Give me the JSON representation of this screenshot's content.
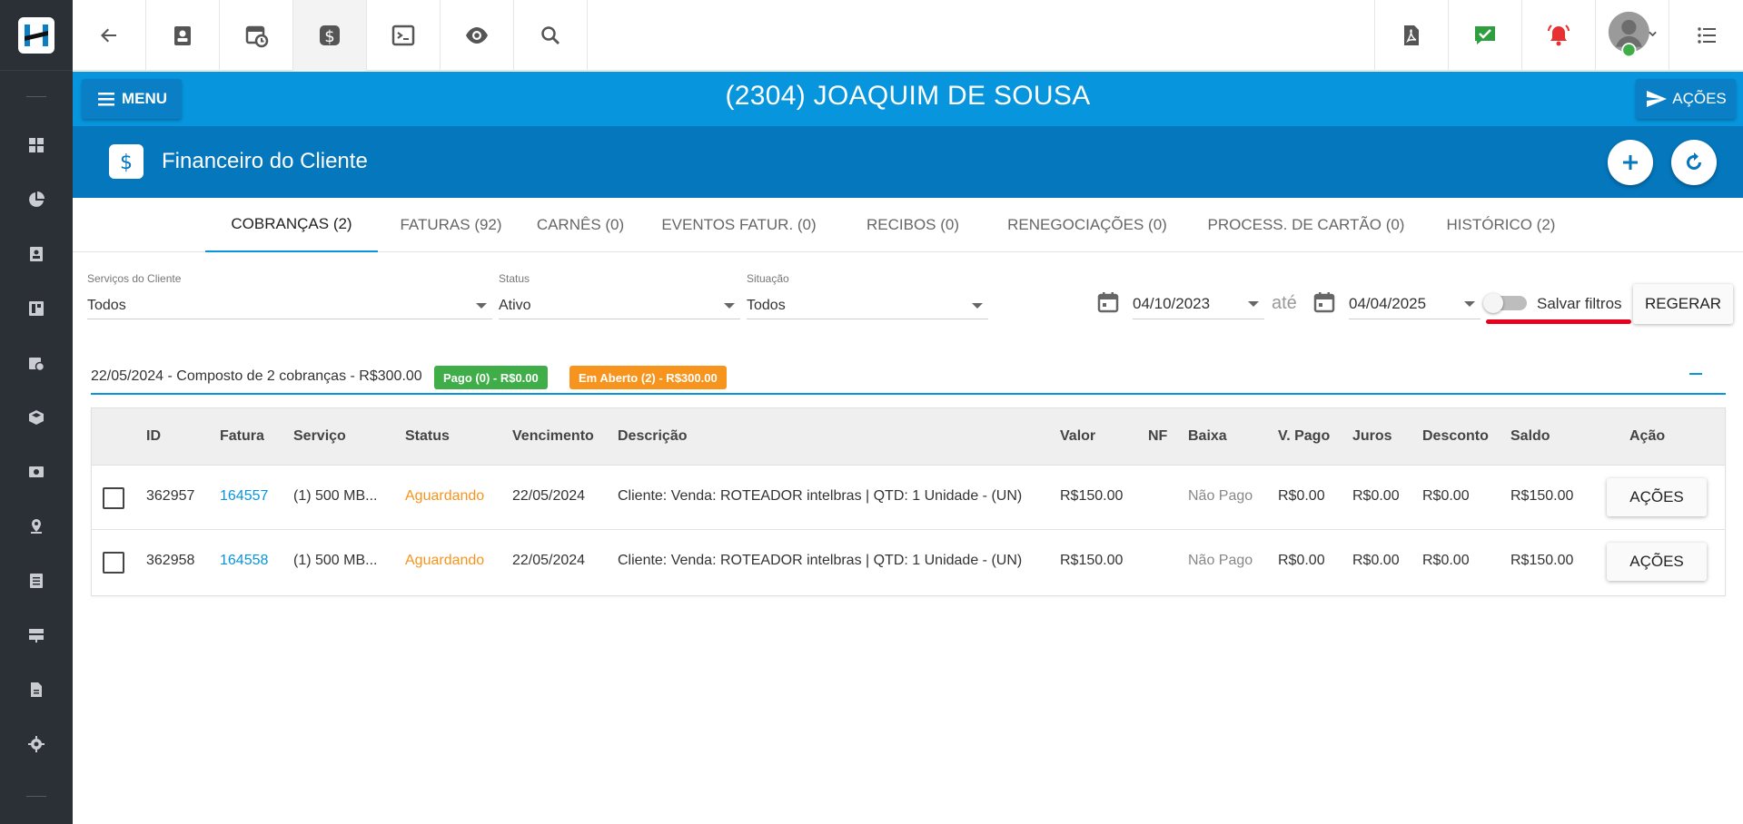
{
  "header": {
    "client_title": "(2304) JOAQUIM DE SOUSA",
    "menu_label": "MENU",
    "acoes_label": "AÇÕES"
  },
  "section": {
    "title": "Financeiro do Cliente"
  },
  "tabs": [
    {
      "label": "COBRANÇAS (2)",
      "active": true
    },
    {
      "label": "FATURAS (92)"
    },
    {
      "label": "CARNÊS (0)"
    },
    {
      "label": "EVENTOS FATUR. (0)"
    },
    {
      "label": "RECIBOS (0)"
    },
    {
      "label": "RENEGOCIAÇÕES (0)"
    },
    {
      "label": "PROCESS. DE CARTÃO (0)"
    },
    {
      "label": "HISTÓRICO (2)"
    }
  ],
  "filters": {
    "servicos": {
      "label": "Serviços do Cliente",
      "value": "Todos"
    },
    "status": {
      "label": "Status",
      "value": "Ativo"
    },
    "situacao": {
      "label": "Situação",
      "value": "Todos"
    },
    "date_from": "04/10/2023",
    "date_sep": "até",
    "date_to": "04/04/2025",
    "salvar_label": "Salvar filtros",
    "regerar_label": "REGERAR"
  },
  "group": {
    "summary": "22/05/2024 - Composto de 2 cobranças - R$300.00",
    "paid_badge": "Pago (0) - R$0.00",
    "open_badge": "Em Aberto (2) - R$300.00"
  },
  "table": {
    "columns": [
      "ID",
      "Fatura",
      "Serviço",
      "Status",
      "Vencimento",
      "Descrição",
      "Valor",
      "NF",
      "Baixa",
      "V. Pago",
      "Juros",
      "Desconto",
      "Saldo",
      "Ação"
    ],
    "rows": [
      {
        "id": "362957",
        "fatura": "164557",
        "servico": "(1) 500 MB...",
        "status": "Aguardando",
        "vencimento": "22/05/2024",
        "descricao": "Cliente: Venda: ROTEADOR intelbras | QTD: 1 Unidade - (UN)",
        "valor": "R$150.00",
        "nf": "",
        "baixa": "Não Pago",
        "v_pago": "R$0.00",
        "juros": "R$0.00",
        "desconto": "R$0.00",
        "saldo": "R$150.00",
        "acao": "AÇÕES"
      },
      {
        "id": "362958",
        "fatura": "164558",
        "servico": "(1) 500 MB...",
        "status": "Aguardando",
        "vencimento": "22/05/2024",
        "descricao": "Cliente: Venda: ROTEADOR intelbras | QTD: 1 Unidade - (UN)",
        "valor": "R$150.00",
        "nf": "",
        "baixa": "Não Pago",
        "v_pago": "R$0.00",
        "juros": "R$0.00",
        "desconto": "R$0.00",
        "saldo": "R$150.00",
        "acao": "AÇÕES"
      }
    ]
  },
  "colors": {
    "primary_blue": "#0795dd",
    "header_blue": "#0477bd",
    "sidebar": "#2b2f36",
    "paid_green": "#3fae49",
    "open_orange": "#f7941d",
    "highlight_red": "#e8001c"
  }
}
